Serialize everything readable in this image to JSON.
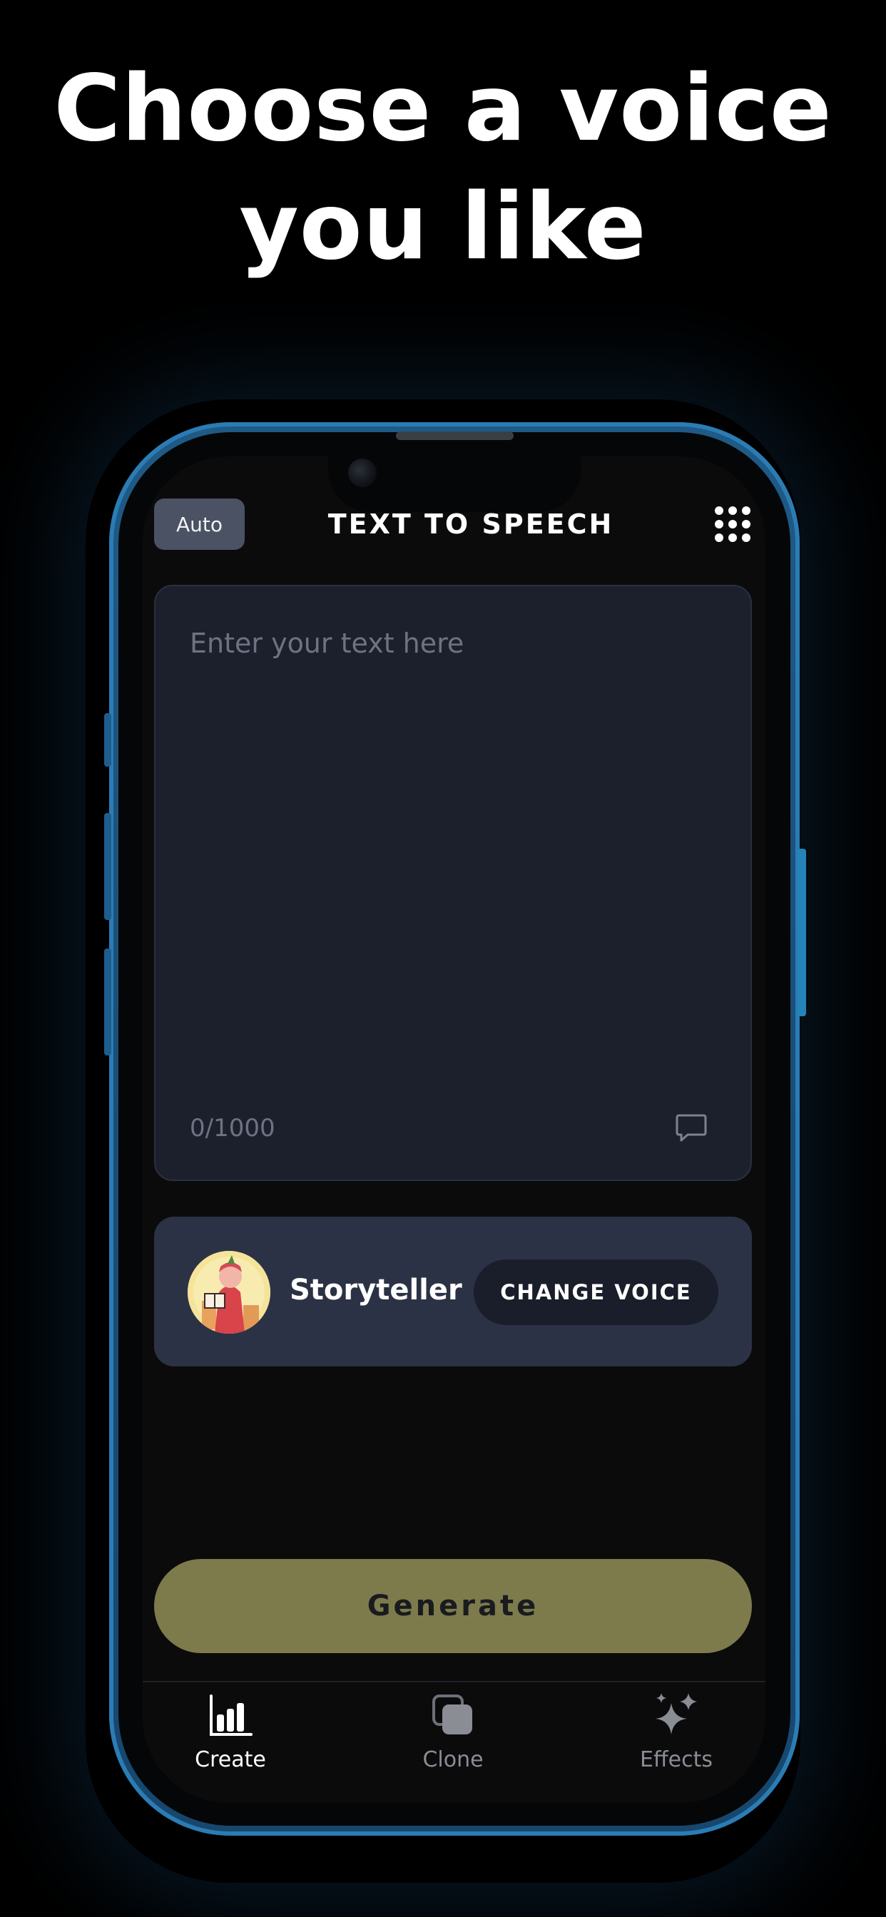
{
  "headline": {
    "line1": "Choose a voice",
    "line2": "you like"
  },
  "app": {
    "auto_label": "Auto",
    "title": "TEXT TO SPEECH",
    "menu_icon": "grid-dots-icon",
    "text_input": {
      "placeholder": "Enter your text here",
      "char_count": "0/1000"
    },
    "comment_icon": "speech-bubble-icon",
    "voice": {
      "name": "Storyteller",
      "change_label": "CHANGE VOICE",
      "avatar_icon": "storyteller-avatar"
    },
    "generate_label": "Generate",
    "tabs": [
      {
        "label": "Create",
        "icon": "bar-chart-icon",
        "active": true
      },
      {
        "label": "Clone",
        "icon": "clone-icon",
        "active": false
      },
      {
        "label": "Effects",
        "icon": "sparkles-icon",
        "active": false
      }
    ]
  },
  "colors": {
    "background": "#000000",
    "phone_frame": "#1f5a86",
    "card_bg": "#1c202c",
    "voice_card_bg": "#2c3245",
    "generate_bg": "#7d7b4b",
    "active_tab": "#ffffff",
    "inactive_tab": "#8a8d94"
  }
}
